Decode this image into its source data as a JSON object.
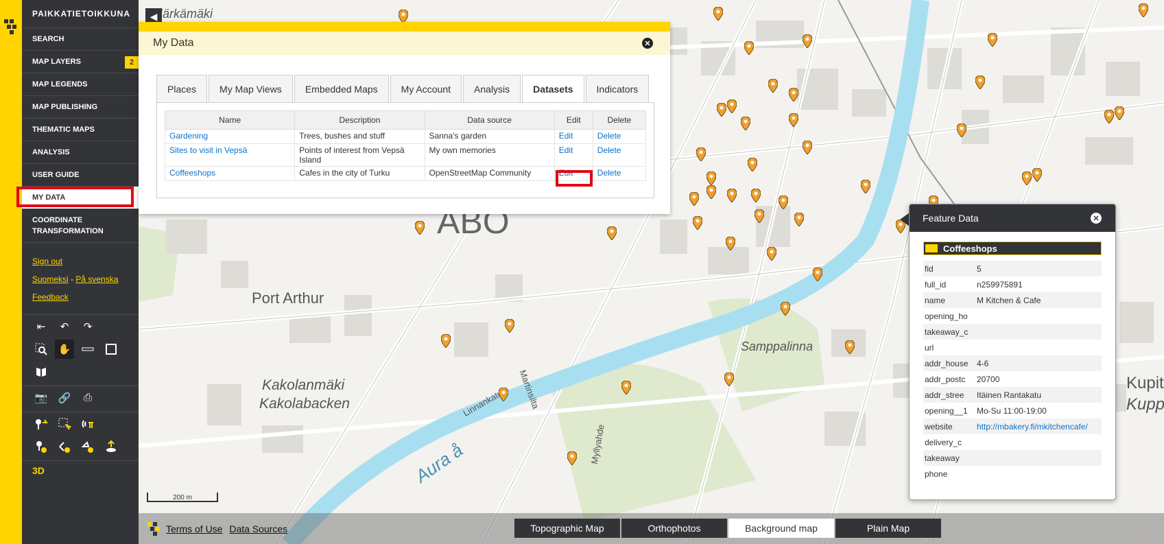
{
  "nav": {
    "brand": "PAIKKATIETOIKKUNA",
    "items": [
      {
        "label": "SEARCH"
      },
      {
        "label": "MAP LAYERS",
        "badge": "2"
      },
      {
        "label": "MAP LEGENDS"
      },
      {
        "label": "MAP PUBLISHING"
      },
      {
        "label": "THEMATIC MAPS"
      },
      {
        "label": "ANALYSIS"
      },
      {
        "label": "USER GUIDE"
      },
      {
        "label": "MY DATA"
      },
      {
        "label": "COORDINATE TRANSFORMATION"
      }
    ],
    "sign_out": "Sign out",
    "lang_fi": "Suomeksi",
    "lang_sep": "-",
    "lang_sv": "På svenska",
    "feedback": "Feedback",
    "three_d": "3D"
  },
  "map": {
    "labels": {
      "harkamaki": "Härkämäki",
      "abo": "ÅBO",
      "port_arthur": "Port Arthur",
      "kakolanmaki": "Kakolanmäki",
      "kakolabacken": "Kakolabacken",
      "samppalinna": "Samppalinna",
      "kupit": "Kupit",
      "kupp": "Kupp",
      "aura": "Aura å",
      "martinsilta": "Martinsilta",
      "linnankatu": "Linnankatu",
      "myllyahde": "Myllyahde"
    },
    "scale": "200 m"
  },
  "mydata": {
    "title": "My Data",
    "tabs": [
      "Places",
      "My Map Views",
      "Embedded Maps",
      "My Account",
      "Analysis",
      "Datasets",
      "Indicators"
    ],
    "columns": [
      "Name",
      "Description",
      "Data source",
      "Edit",
      "Delete"
    ],
    "rows": [
      {
        "name": "Gardening",
        "description": "Trees, bushes and stuff",
        "source": "Sanna's garden",
        "edit": "Edit",
        "delete": "Delete"
      },
      {
        "name": "Sites to visit in Vepsä",
        "description": "Points of interest from Vepsä Island",
        "source": "My own memories",
        "edit": "Edit",
        "delete": "Delete"
      },
      {
        "name": "Coffeeshops",
        "description": "Cafes in the city of Turku",
        "source": "OpenStreetMap Community",
        "edit": "Edit",
        "delete": "Delete"
      }
    ]
  },
  "feature": {
    "title": "Feature Data",
    "layer": "Coffeeshops",
    "rows": [
      {
        "k": "fid",
        "v": "5"
      },
      {
        "k": "full_id",
        "v": "n259975891"
      },
      {
        "k": "name",
        "v": "M Kitchen & Cafe"
      },
      {
        "k": "opening_ho",
        "v": ""
      },
      {
        "k": "takeaway_c",
        "v": ""
      },
      {
        "k": "url",
        "v": ""
      },
      {
        "k": "addr_house",
        "v": "4-6"
      },
      {
        "k": "addr_postc",
        "v": "20700"
      },
      {
        "k": "addr_stree",
        "v": "Itäinen Rantakatu"
      },
      {
        "k": "opening__1",
        "v": "Mo-Su 11:00-19:00"
      },
      {
        "k": "website",
        "v": "http://mbakery.fi/mkitchencafe/"
      },
      {
        "k": "delivery_c",
        "v": ""
      },
      {
        "k": "takeaway",
        "v": ""
      },
      {
        "k": "phone",
        "v": ""
      }
    ]
  },
  "bottom": {
    "terms": "Terms of Use",
    "sources": "Data Sources",
    "bg": [
      "Topographic Map",
      "Orthophotos",
      "Background map",
      "Plain Map"
    ]
  },
  "colors": {
    "accent": "#ffd400",
    "dark": "#333438",
    "highlight": "#e30613",
    "river": "#a8dff0",
    "link": "#0b72c9"
  }
}
